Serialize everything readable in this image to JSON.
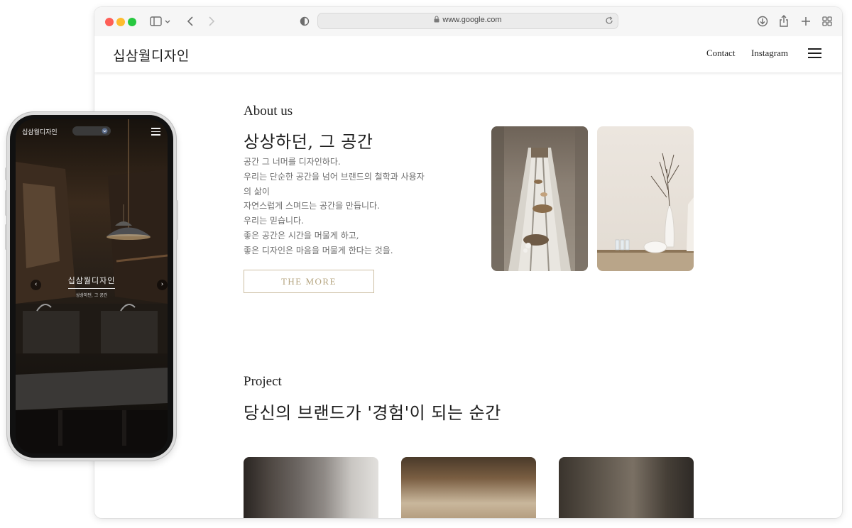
{
  "browser": {
    "url": "www.google.com"
  },
  "site": {
    "logo": "십삼월디자인",
    "nav": [
      "Contact",
      "Instagram"
    ]
  },
  "about": {
    "eyebrow": "About us",
    "title": "상상하던, 그 공간",
    "body_lines": [
      "공간 그 너머를 디자인하다.",
      "우리는 단순한 공간을 넘어 브랜드의 철학과 사용자",
      "의 삶이",
      "자연스럽게 스며드는 공간을 만듭니다.",
      "우리는 믿습니다.",
      "좋은 공간은 시간을 머물게 하고,",
      "좋은 디자인은 마음을 머물게 한다는 것을."
    ],
    "button_label": "THE MORE"
  },
  "project": {
    "eyebrow": "Project",
    "title": "당신의 브랜드가 '경험'이 되는 순간"
  },
  "mobile": {
    "logo": "십삼월디자인",
    "hero_title": "십삼월디자인",
    "hero_subtitle": "상상하던, 그 공간"
  },
  "colors": {
    "accent_gold": "#b6a682",
    "text_dark": "#1e1e1e",
    "text_muted": "#6e6e6e"
  }
}
